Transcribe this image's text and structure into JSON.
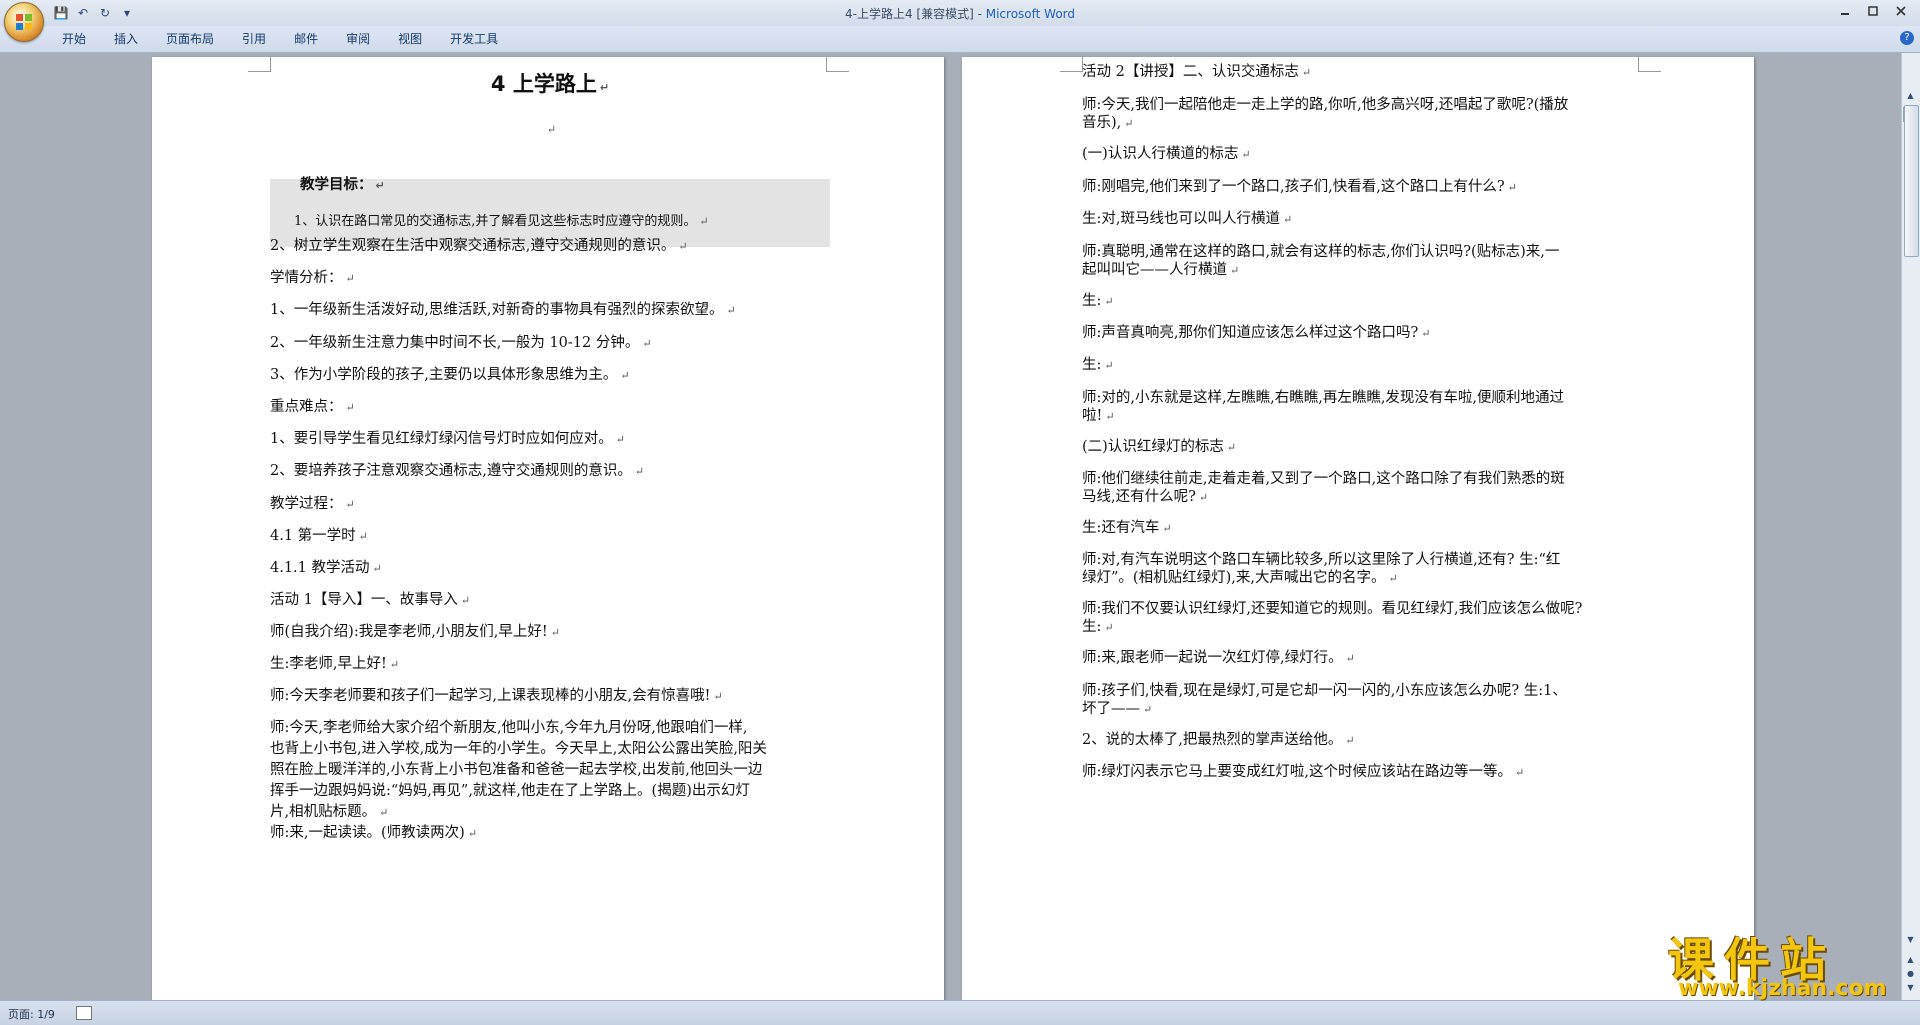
{
  "window": {
    "title_doc": "4-上学路上4 [兼容模式]",
    "title_sep": " - ",
    "title_app": "Microsoft Word"
  },
  "qat": {
    "save": "💾",
    "undo": "↶",
    "redo": "↻",
    "more": "▾"
  },
  "ribbon": {
    "tabs": [
      "开始",
      "插入",
      "页面布局",
      "引用",
      "邮件",
      "审阅",
      "视图",
      "开发工具"
    ],
    "help": "?"
  },
  "page1": {
    "title": "4  上学路上",
    "lines": [
      "教学目标：",
      "1、认识在路口常见的交通标志,并了解看见这些标志时应遵守的规则。",
      "2、树立学生观察在生活中观察交通标志,遵守交通规则的意识。",
      "学情分析：",
      "1、一年级新生活泼好动,思维活跃,对新奇的事物具有强烈的探索欲望。",
      "2、一年级新生注意力集中时间不长,一般为 10-12 分钟。",
      "3、作为小学阶段的孩子,主要仍以具体形象思维为主。",
      "重点难点：",
      "1、要引导学生看见红绿灯绿闪信号灯时应如何应对。",
      "2、要培养孩子注意观察交通标志,遵守交通规则的意识。",
      "教学过程：",
      "4.1 第一学时",
      "4.1.1 教学活动",
      "活动 1【导入】一、故事导入",
      "师(自我介绍):我是李老师,小朋友们,早上好!",
      "生:李老师,早上好!",
      "师:今天李老师要和孩子们一起学习,上课表现棒的小朋友,会有惊喜哦!",
      "师:今天,李老师给大家介绍个新朋友,他叫小东,今年九月份呀,他跟咱们一样,",
      "也背上小书包,进入学校,成为一年的小学生。今天早上,太阳公公露出笑脸,阳关",
      "照在脸上暖洋洋的,小东背上小书包准备和爸爸一起去学校,出发前,他回头一边",
      "挥手一边跟妈妈说:“妈妈,再见”,就这样,他走在了上学路上。(揭题)出示幻灯",
      "片,相机贴标题。",
      "师:来,一起读读。(师教读两次)"
    ]
  },
  "page2": {
    "lines": [
      "活动 2【讲授】二、认识交通标志",
      "师:今天,我们一起陪他走一走上学的路,你听,他多高兴呀,还唱起了歌呢?(播放",
      "音乐),",
      "(一)认识人行横道的标志",
      "师:刚唱完,他们来到了一个路口,孩子们,快看看,这个路口上有什么?",
      "生:对,斑马线也可以叫人行横道",
      "师:真聪明,通常在这样的路口,就会有这样的标志,你们认识吗?(贴标志)来,一",
      "起叫叫它——人行横道",
      "生:",
      "师:声音真响亮,那你们知道应该怎么样过这个路口吗?",
      "生:",
      "师:对的,小东就是这样,左瞧瞧,右瞧瞧,再左瞧瞧,发现没有车啦,便顺利地通过",
      "啦!",
      "(二)认识红绿灯的标志",
      "师:他们继续往前走,走着走着,又到了一个路口,这个路口除了有我们熟悉的斑",
      "马线,还有什么呢?",
      "生:还有汽车",
      "师:对,有汽车说明这个路口车辆比较多,所以这里除了人行横道,还有? 生:“红",
      "绿灯”。(相机贴红绿灯),来,大声喊出它的名字。",
      "师:我们不仅要认识红绿灯,还要知道它的规则。看见红绿灯,我们应该怎么做呢?",
      "生:",
      "师:来,跟老师一起说一次红灯停,绿灯行。",
      "师:孩子们,快看,现在是绿灯,可是它却一闪一闪的,小东应该怎么办呢? 生:1、",
      "坏了——",
      "2、说的太棒了,把最热烈的掌声送给他。",
      "师:绿灯闪表示它马上要变成红灯啦,这个时候应该站在路边等一等。"
    ]
  },
  "paragraph_mark": "↵",
  "status": {
    "page_count": "页面: 1/9"
  },
  "watermark": {
    "main": "课件站",
    "url": "www.kjzhan.com"
  },
  "colors": {
    "app_title": "#1d5fb8",
    "watermark": "#f3c50b",
    "background": "#a9afb8"
  }
}
